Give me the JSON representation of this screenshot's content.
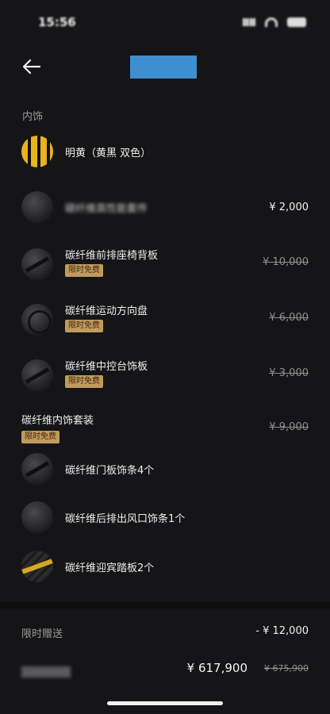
{
  "status": {
    "time": "15:56"
  },
  "section": {
    "label": "内饰"
  },
  "items": [
    {
      "name": "明黄（黄黑 双色）",
      "price": "",
      "badge": "",
      "icon": "yellow-black-swatch"
    },
    {
      "name": "碳纤维高性能套件",
      "price": "¥ 2,000",
      "badge": "",
      "icon": "carbon-part"
    },
    {
      "name": "碳纤维前排座椅背板",
      "price": "¥ 10,000",
      "badge": "限时免费",
      "icon": "seat-back"
    },
    {
      "name": "碳纤维运动方向盘",
      "price": "¥ 6,000",
      "badge": "限时免费",
      "icon": "steering-wheel"
    },
    {
      "name": "碳纤维中控台饰板",
      "price": "¥ 3,000",
      "badge": "限时免费",
      "icon": "console-trim"
    }
  ],
  "group": {
    "name": "碳纤维内饰套装",
    "badge": "限时免费",
    "price": "¥ 9,000",
    "sub_items": [
      {
        "name": "碳纤维门板饰条4个",
        "icon": "door-trim"
      },
      {
        "name": "碳纤维后排出风口饰条1个",
        "icon": "air-vent-trim"
      },
      {
        "name": "碳纤维迎宾踏板2个",
        "icon": "door-sill"
      }
    ]
  },
  "promo": {
    "label": "限时赠送",
    "value": "- ¥ 12,000"
  },
  "total": {
    "price": "¥ 617,900",
    "original": "¥ 675,900"
  }
}
